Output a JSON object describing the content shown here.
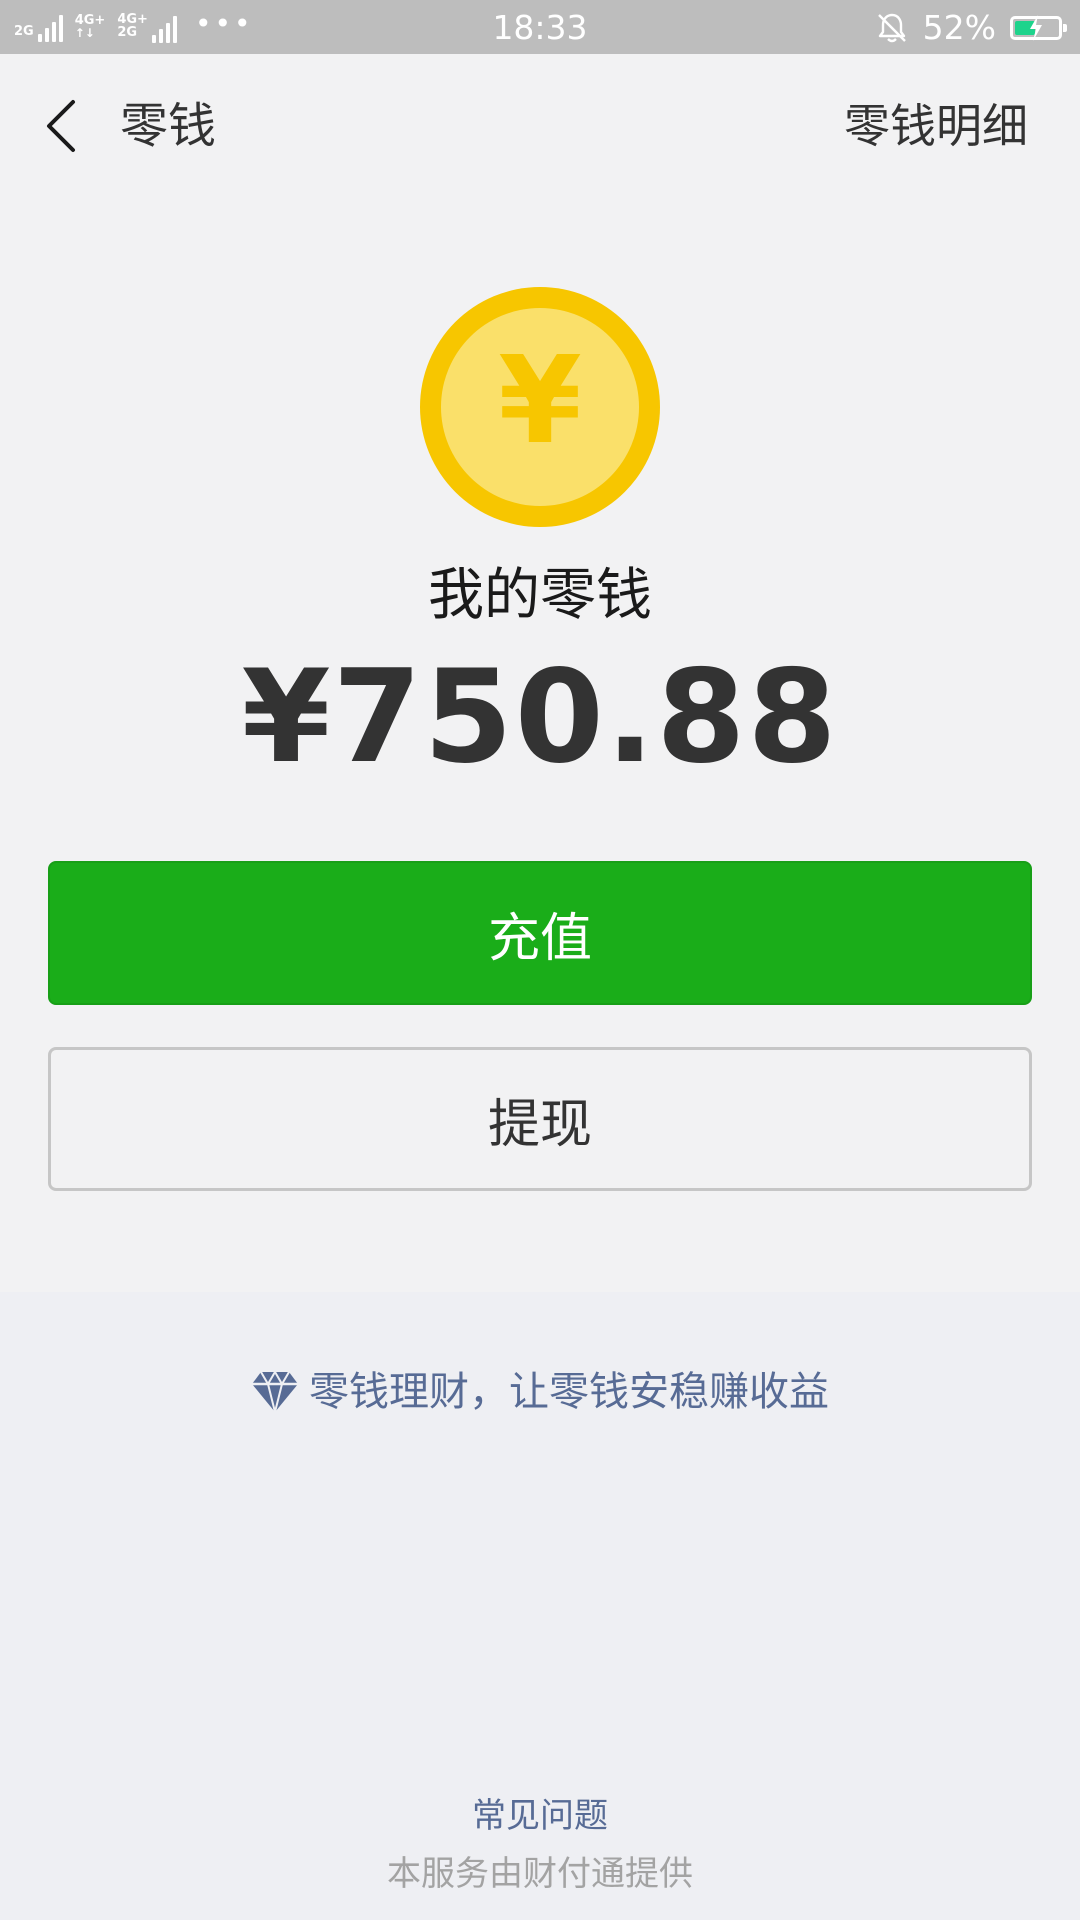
{
  "status_bar": {
    "network_1": "2G",
    "network_2": "4G+",
    "network_3_top": "4G+",
    "network_3_bottom": "2G",
    "more": "•••",
    "time": "18:33",
    "battery_percent": "52%",
    "battery_level": 0.52,
    "battery_color": "#1ed38c"
  },
  "nav": {
    "title": "零钱",
    "detail_link": "零钱明细"
  },
  "balance": {
    "coin_symbol": "¥",
    "label": "我的零钱",
    "amount": "¥750.88"
  },
  "buttons": {
    "recharge": "充值",
    "withdraw": "提现"
  },
  "colors": {
    "primary_green": "#1aad19",
    "link_blue": "#576b95",
    "coin_outer": "#f7c600",
    "coin_inner": "#fae06a"
  },
  "footer": {
    "promo_text": "零钱理财，让零钱安稳赚收益",
    "faq": "常见问题",
    "provider": "本服务由财付通提供"
  }
}
